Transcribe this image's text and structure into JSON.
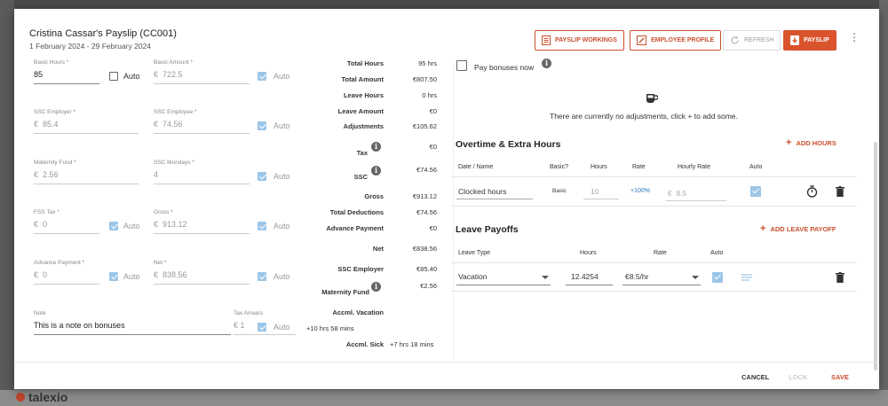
{
  "background": {
    "brand": "talexio",
    "accent": "#d9532c"
  },
  "header": {
    "title": "Cristina Cassar's Payslip (CC001)",
    "period": "1 February 2024 - 29 February 2024",
    "buttons": {
      "workings": "PAYSLIP WORKINGS",
      "profile": "EMPLOYEE PROFILE",
      "refresh": "REFRESH",
      "payslip": "PAYSLIP"
    }
  },
  "form": {
    "basic_hours": {
      "label": "Basic Hours *",
      "value": "85",
      "auto": "Auto",
      "auto_checked": false
    },
    "basic_amount": {
      "label": "Basic Amount *",
      "prefix": "€",
      "value": "722.5",
      "auto": "Auto",
      "auto_checked": true
    },
    "ssc_employer": {
      "label": "SSC Employer *",
      "prefix": "€",
      "value": "85.4"
    },
    "ssc_employee": {
      "label": "SSC Employee *",
      "prefix": "€",
      "value": "74.56",
      "auto": "Auto",
      "auto_checked": true
    },
    "maternity_fund": {
      "label": "Maternity Fund *",
      "prefix": "€",
      "value": "2.56"
    },
    "ssc_mondays": {
      "label": "SSC Mondays *",
      "value": "4",
      "auto": "Auto",
      "auto_checked": true
    },
    "fss_tax": {
      "label": "FSS Tax *",
      "prefix": "€",
      "value": "0",
      "auto": "Auto",
      "auto_checked": true
    },
    "gross": {
      "label": "Gross *",
      "prefix": "€",
      "value": "913.12",
      "auto": "Auto",
      "auto_checked": true
    },
    "advance_payment": {
      "label": "Advance Payment *",
      "prefix": "€",
      "value": "0",
      "auto": "Auto",
      "auto_checked": true
    },
    "net": {
      "label": "Net *",
      "prefix": "€",
      "value": "838.56",
      "auto": "Auto",
      "auto_checked": true
    },
    "note": {
      "label": "Note",
      "value": "This is a note on bonuses"
    },
    "tax_arrears": {
      "label": "Tax Arrears",
      "prefix": "€",
      "value": "1",
      "auto": "Auto",
      "auto_checked": true
    }
  },
  "summary": [
    {
      "label": "Total Hours",
      "value": "95 hrs"
    },
    {
      "label": "Total Amount",
      "value": "€807.50"
    },
    {
      "label": "Leave Hours",
      "value": "0 hrs"
    },
    {
      "label": "Leave Amount",
      "value": "€0"
    },
    {
      "label": "Adjustments",
      "value": "€105.62"
    },
    {
      "label": "Tax",
      "value": "€0"
    },
    {
      "label": "SSC",
      "value": "€74.56"
    },
    {
      "label": "Gross",
      "value": "€913.12"
    },
    {
      "label": "Total Deductions",
      "value": "€74.56"
    },
    {
      "label": "Advance Payment",
      "value": "€0"
    },
    {
      "label": "Net",
      "value": "€838.56"
    },
    {
      "label": "SSC Employer",
      "value": "€85.40"
    },
    {
      "label": "Maternity Fund",
      "value": "€2.56"
    },
    {
      "label": "Accml. Vacation",
      "value": "+10 hrs 58 mins"
    },
    {
      "label": "Accml. Sick",
      "value": "+7 hrs 18 mins"
    }
  ],
  "right": {
    "pay_bonuses": "Pay bonuses now",
    "no_adjustments": "There are currently no adjustments, click + to add some.",
    "overtime": {
      "title": "Overtime & Extra Hours",
      "add": "ADD HOURS",
      "columns": [
        "Date / Name",
        "Basic?",
        "Hours",
        "Rate",
        "Hourly Rate",
        "Auto"
      ],
      "row": {
        "name": "Clocked hours",
        "basic": "Basic",
        "hours": "10",
        "rate": "+100%",
        "hourly_prefix": "€",
        "hourly": "8.5",
        "auto_checked": true
      }
    },
    "leave": {
      "title": "Leave Payoffs",
      "add": "ADD LEAVE PAYOFF",
      "columns": [
        "Leave Type",
        "Hours",
        "Rate",
        "Auto"
      ],
      "row": {
        "type": "Vacation",
        "hours": "12.4254",
        "rate": "€8.5/hr",
        "auto_checked": true
      }
    }
  },
  "footer": {
    "cancel": "CANCEL",
    "lock": "LOCK",
    "save": "SAVE"
  }
}
